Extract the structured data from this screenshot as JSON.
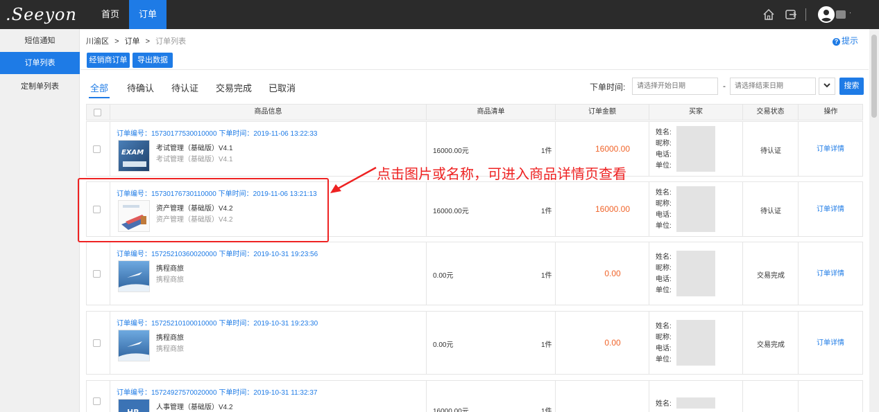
{
  "app": {
    "logo": ".Seeyon",
    "nav": [
      {
        "label": "首页"
      },
      {
        "label": "订单"
      }
    ]
  },
  "sidebar": {
    "items": [
      {
        "label": "短信通知",
        "active": false
      },
      {
        "label": "订单列表",
        "active": true
      },
      {
        "label": "定制单列表",
        "active": false
      }
    ]
  },
  "breadcrumb": {
    "region": "川渝区",
    "sep": ">",
    "section": "订单",
    "page": "订单列表"
  },
  "hint": "提示",
  "buttons": {
    "dealer_order": "经销商订单",
    "export": "导出数据",
    "search": "搜索"
  },
  "tabs": [
    {
      "label": "全部",
      "active": true
    },
    {
      "label": "待确认"
    },
    {
      "label": "待认证"
    },
    {
      "label": "交易完成"
    },
    {
      "label": "已取消"
    }
  ],
  "filter": {
    "date_label": "下单时间:",
    "start_placeholder": "请选择开始日期",
    "end_placeholder": "请选择结束日期",
    "dash": "-"
  },
  "table": {
    "headers": [
      "商品信息",
      "商品清单",
      "订单金额",
      "买家",
      "交易状态",
      "操作"
    ]
  },
  "buyer_labels": {
    "name": "姓名:",
    "nickname": "昵称:",
    "phone": "电话:",
    "unit": "单位:"
  },
  "orders": [
    {
      "id_text": "订单编号：15730177530010000 下单时间：2019-11-06 13:22:33",
      "name": "考试管理（基础版）V4.1",
      "sub": "考试管理（基础版）V4.1",
      "price": "16000.00元",
      "qty": "1件",
      "amount": "16000.00",
      "status": "待认证",
      "action": "订单详情",
      "thumb": "exam"
    },
    {
      "id_text": "订单编号：15730176730110000 下单时间：2019-11-06 13:21:13",
      "name": "资产管理（基础版）V4.2",
      "sub": "资产管理（基础版）V4.2",
      "price": "16000.00元",
      "qty": "1件",
      "amount": "16000.00",
      "status": "待认证",
      "action": "订单详情",
      "thumb": "asset"
    },
    {
      "id_text": "订单编号：15725210360020000 下单时间：2019-10-31 19:23:56",
      "name": "携程商旅",
      "sub": "携程商旅",
      "price": "0.00元",
      "qty": "1件",
      "amount": "0.00",
      "status": "交易完成",
      "action": "订单详情",
      "thumb": "sky"
    },
    {
      "id_text": "订单编号：15725210100010000 下单时间：2019-10-31 19:23:30",
      "name": "携程商旅",
      "sub": "携程商旅",
      "price": "0.00元",
      "qty": "1件",
      "amount": "0.00",
      "status": "交易完成",
      "action": "订单详情",
      "thumb": "sky"
    },
    {
      "id_text": "订单编号：15724927570020000 下单时间：2019-10-31 11:32:37",
      "name": "人事管理（基础版）V4.2",
      "sub": "",
      "price": "16000.00元",
      "qty": "1件",
      "amount": "",
      "status": "",
      "action": "",
      "thumb": "hr"
    }
  ],
  "annotation": "点击图片或名称，可进入商品详情页查看",
  "colors": {
    "primary": "#1e7be6",
    "topbar": "#2b2b2b",
    "amount": "#f0642a",
    "annotation": "#e22222"
  }
}
